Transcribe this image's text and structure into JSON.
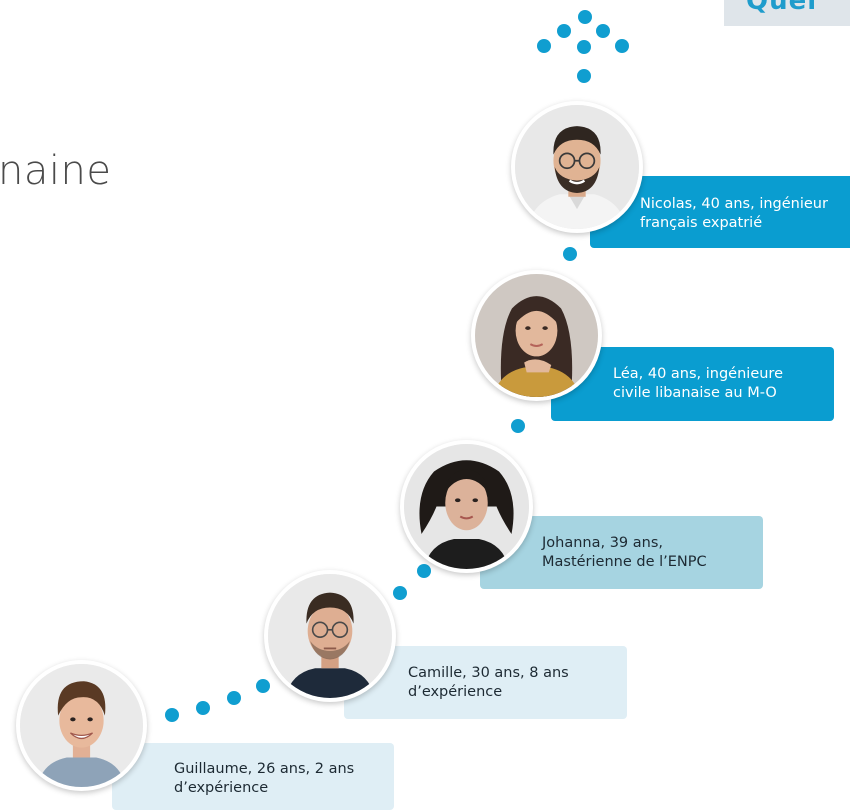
{
  "title_fragment": "naine",
  "corner_tag_text": "Quel",
  "colors": {
    "accent": "#109ed0",
    "card_dark": "#0a9dd0",
    "card_mid": "#a6d4e1",
    "card_light": "#dfeef5"
  },
  "personas": [
    {
      "name_line1": "Nicolas, 40 ans, ingénieur",
      "name_line2": "français expatrié",
      "style": "dark",
      "photo": "man-beard-glasses-photo"
    },
    {
      "name_line1": "Léa, 40 ans, ingénieure",
      "name_line2": "civile libanaise au M-O",
      "style": "dark",
      "photo": "woman-dark-hair-photo"
    },
    {
      "name_line1": "Johanna, 39 ans,",
      "name_line2": "Mastérienne de l’ENPC",
      "style": "mid",
      "photo": "woman-curly-hair-photo"
    },
    {
      "name_line1": "Camille, 30 ans, 8 ans",
      "name_line2": "d’expérience",
      "style": "light",
      "photo": "man-glasses-photo"
    },
    {
      "name_line1": "Guillaume, 26 ans, 2 ans",
      "name_line2": "d’expérience",
      "style": "light",
      "photo": "young-man-photo"
    }
  ]
}
